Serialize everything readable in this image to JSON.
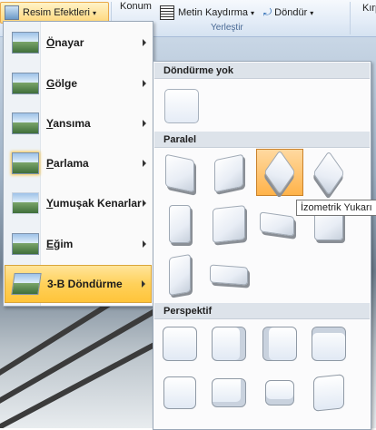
{
  "ribbon": {
    "resim_efektleri": "Resim Efektleri",
    "konum": "Konum",
    "metin_kaydirma": "Metin Kaydırma",
    "dondur": "Döndür",
    "kirp": "Kırp",
    "group_label": "Yerleştir"
  },
  "menu": {
    "items": [
      {
        "label_underline": "Ö",
        "label_rest": "nayar",
        "icon": "preset-icon"
      },
      {
        "label_underline": "G",
        "label_rest": "ölge",
        "icon": "shadow-icon"
      },
      {
        "label_underline": "Y",
        "label_rest": "ansıma",
        "icon": "reflection-icon"
      },
      {
        "label_underline": "P",
        "label_rest": "arlama",
        "icon": "glow-icon"
      },
      {
        "label_underline": "Y",
        "label_rest": "umuşak Kenarlar",
        "icon": "soft-edges-icon"
      },
      {
        "label_underline": "E",
        "label_rest": "ğim",
        "icon": "bevel-icon"
      },
      {
        "label_underline": "",
        "label_rest": "3-B Döndürme",
        "icon": "3d-rotation-icon",
        "active": true
      }
    ]
  },
  "gallery": {
    "sections": {
      "none": "Döndürme yok",
      "parallel": "Paralel",
      "perspective": "Perspektif"
    },
    "tooltip": "İzometrik Yukarı"
  },
  "colors": {
    "accent": "#ffc43a",
    "header_bg": "#dde3ea"
  }
}
